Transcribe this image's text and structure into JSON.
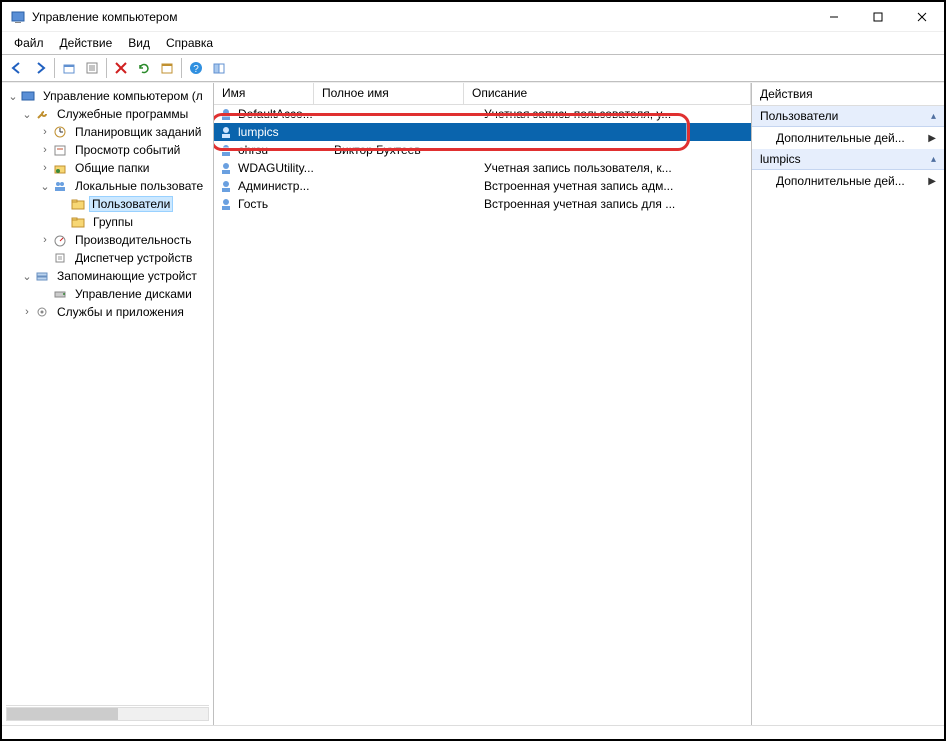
{
  "title": "Управление компьютером",
  "menu": {
    "file": "Файл",
    "action": "Действие",
    "view": "Вид",
    "help": "Справка"
  },
  "tree": {
    "root": "Управление компьютером (л",
    "sys_tools": "Служебные программы",
    "task_sched": "Планировщик заданий",
    "event_viewer": "Просмотр событий",
    "shared": "Общие папки",
    "local_users": "Локальные пользовате",
    "users": "Пользователи",
    "groups": "Группы",
    "perf": "Производительность",
    "devmgr": "Диспетчер устройств",
    "storage": "Запоминающие устройст",
    "diskmgmt": "Управление дисками",
    "services": "Службы и приложения"
  },
  "columns": {
    "name": "Имя",
    "fullname": "Полное имя",
    "desc": "Описание"
  },
  "users": [
    {
      "name": "DefaultAcco...",
      "fullname": "",
      "desc": "Учетная запись пользователя, у..."
    },
    {
      "name": "lumpics",
      "fullname": "",
      "desc": ""
    },
    {
      "name": "ohrsu",
      "fullname": "Виктор Бухтеев",
      "desc": ""
    },
    {
      "name": "WDAGUtility...",
      "fullname": "",
      "desc": "Учетная запись пользователя, к..."
    },
    {
      "name": "Администр...",
      "fullname": "",
      "desc": "Встроенная учетная запись адм..."
    },
    {
      "name": "Гость",
      "fullname": "",
      "desc": "Встроенная учетная запись для ..."
    }
  ],
  "actions": {
    "title": "Действия",
    "group_users": "Пользователи",
    "group_lumpics": "lumpics",
    "more": "Дополнительные дей..."
  }
}
